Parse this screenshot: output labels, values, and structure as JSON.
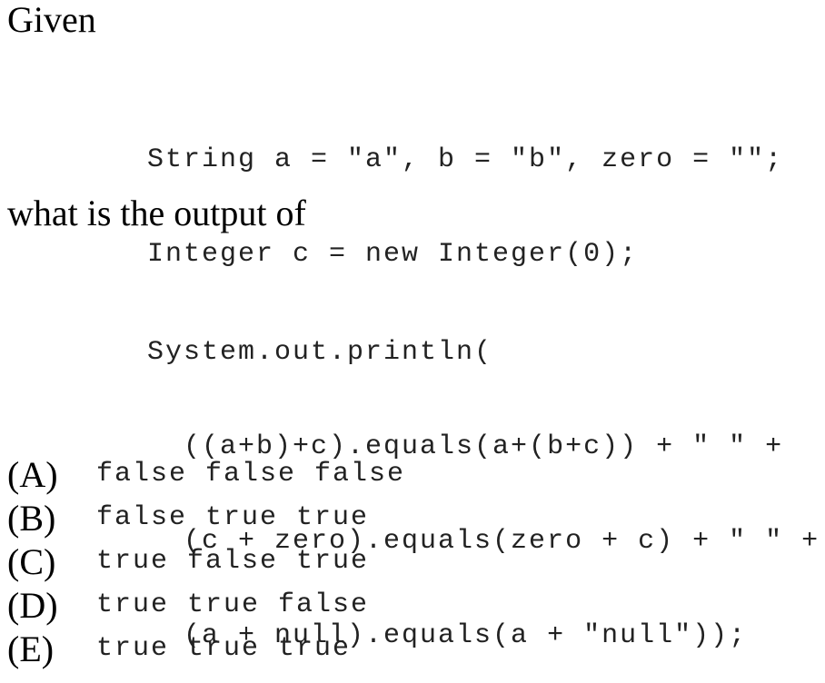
{
  "intro": "Given",
  "declarations": [
    "String a = \"a\", b = \"b\", zero = \"\";",
    "Integer c = new Integer(0);"
  ],
  "question": "what is the output of",
  "statement": [
    "System.out.println(",
    "  ((a+b)+c).equals(a+(b+c)) + \" \" +",
    "  (c + zero).equals(zero + c) + \" \" +",
    "  (a + null).equals(a + \"null\"));"
  ],
  "options": [
    {
      "letter": "(A)",
      "text": "false false false"
    },
    {
      "letter": "(B)",
      "text": "false true true"
    },
    {
      "letter": "(C)",
      "text": "true false true"
    },
    {
      "letter": "(D)",
      "text": "true true false"
    },
    {
      "letter": "(E)",
      "text": "true true true"
    }
  ]
}
